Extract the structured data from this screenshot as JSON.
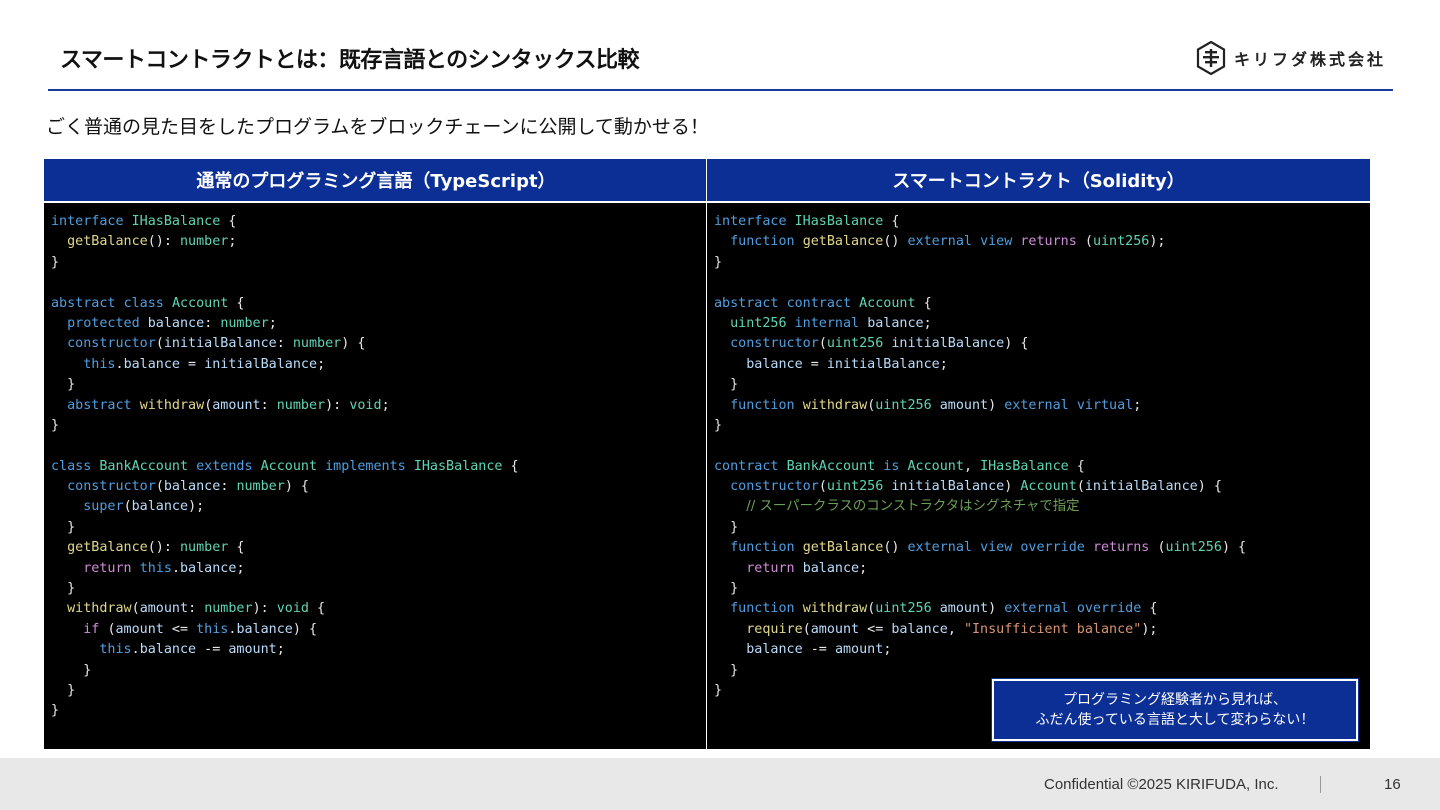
{
  "header": {
    "title": "スマートコントラクトとは：既存言語とのシンタックス比較",
    "logo_text": "キリフダ株式会社",
    "logo_icon": "kirifuda-logo-icon"
  },
  "subtitle": "ごく普通の見た目をしたプログラムをブロックチェーンに公開して動かせる！",
  "panels": {
    "left_title": "通常のプログラミング言語（TypeScript）",
    "right_title": "スマートコントラクト（Solidity）"
  },
  "code_colors": {
    "keyword": "#4f9ee0",
    "type": "#5fd4b4",
    "function": "#e2d88a",
    "variable": "#b9dcfa",
    "control": "#d08ad8",
    "string": "#d89470",
    "comment": "#6aa055"
  },
  "typescript_code": [
    [
      [
        "kw",
        "interface "
      ],
      [
        "ty",
        "IHasBalance"
      ],
      [
        "op",
        " {"
      ]
    ],
    [
      [
        "op",
        "  "
      ],
      [
        "fn",
        "getBalance"
      ],
      [
        "op",
        "(): "
      ],
      [
        "ty",
        "number"
      ],
      [
        "op",
        ";"
      ]
    ],
    [
      [
        "op",
        "}"
      ]
    ],
    [],
    [
      [
        "kw",
        "abstract "
      ],
      [
        "kw",
        "class "
      ],
      [
        "ty",
        "Account"
      ],
      [
        "op",
        " {"
      ]
    ],
    [
      [
        "op",
        "  "
      ],
      [
        "kw",
        "protected "
      ],
      [
        "va",
        "balance"
      ],
      [
        "op",
        ": "
      ],
      [
        "ty",
        "number"
      ],
      [
        "op",
        ";"
      ]
    ],
    [
      [
        "op",
        "  "
      ],
      [
        "kw",
        "constructor"
      ],
      [
        "op",
        "("
      ],
      [
        "va",
        "initialBalance"
      ],
      [
        "op",
        ": "
      ],
      [
        "ty",
        "number"
      ],
      [
        "op",
        ") {"
      ]
    ],
    [
      [
        "op",
        "    "
      ],
      [
        "kw",
        "this"
      ],
      [
        "op",
        "."
      ],
      [
        "va",
        "balance"
      ],
      [
        "op",
        " = "
      ],
      [
        "va",
        "initialBalance"
      ],
      [
        "op",
        ";"
      ]
    ],
    [
      [
        "op",
        "  }"
      ]
    ],
    [
      [
        "op",
        "  "
      ],
      [
        "kw",
        "abstract "
      ],
      [
        "fn",
        "withdraw"
      ],
      [
        "op",
        "("
      ],
      [
        "va",
        "amount"
      ],
      [
        "op",
        ": "
      ],
      [
        "ty",
        "number"
      ],
      [
        "op",
        "): "
      ],
      [
        "ty",
        "void"
      ],
      [
        "op",
        ";"
      ]
    ],
    [
      [
        "op",
        "}"
      ]
    ],
    [],
    [
      [
        "kw",
        "class "
      ],
      [
        "ty",
        "BankAccount"
      ],
      [
        "kw",
        " extends "
      ],
      [
        "ty",
        "Account"
      ],
      [
        "kw",
        " implements "
      ],
      [
        "ty",
        "IHasBalance"
      ],
      [
        "op",
        " {"
      ]
    ],
    [
      [
        "op",
        "  "
      ],
      [
        "kw",
        "constructor"
      ],
      [
        "op",
        "("
      ],
      [
        "va",
        "balance"
      ],
      [
        "op",
        ": "
      ],
      [
        "ty",
        "number"
      ],
      [
        "op",
        ") {"
      ]
    ],
    [
      [
        "op",
        "    "
      ],
      [
        "kw",
        "super"
      ],
      [
        "op",
        "("
      ],
      [
        "va",
        "balance"
      ],
      [
        "op",
        ");"
      ]
    ],
    [
      [
        "op",
        "  }"
      ]
    ],
    [
      [
        "op",
        "  "
      ],
      [
        "fn",
        "getBalance"
      ],
      [
        "op",
        "(): "
      ],
      [
        "ty",
        "number"
      ],
      [
        "op",
        " {"
      ]
    ],
    [
      [
        "op",
        "    "
      ],
      [
        "ct",
        "return "
      ],
      [
        "kw",
        "this"
      ],
      [
        "op",
        "."
      ],
      [
        "va",
        "balance"
      ],
      [
        "op",
        ";"
      ]
    ],
    [
      [
        "op",
        "  }"
      ]
    ],
    [
      [
        "op",
        "  "
      ],
      [
        "fn",
        "withdraw"
      ],
      [
        "op",
        "("
      ],
      [
        "va",
        "amount"
      ],
      [
        "op",
        ": "
      ],
      [
        "ty",
        "number"
      ],
      [
        "op",
        "): "
      ],
      [
        "ty",
        "void"
      ],
      [
        "op",
        " {"
      ]
    ],
    [
      [
        "op",
        "    "
      ],
      [
        "ct",
        "if "
      ],
      [
        "op",
        "("
      ],
      [
        "va",
        "amount"
      ],
      [
        "op",
        " <= "
      ],
      [
        "kw",
        "this"
      ],
      [
        "op",
        "."
      ],
      [
        "va",
        "balance"
      ],
      [
        "op",
        ") {"
      ]
    ],
    [
      [
        "op",
        "      "
      ],
      [
        "kw",
        "this"
      ],
      [
        "op",
        "."
      ],
      [
        "va",
        "balance"
      ],
      [
        "op",
        " -= "
      ],
      [
        "va",
        "amount"
      ],
      [
        "op",
        ";"
      ]
    ],
    [
      [
        "op",
        "    }"
      ]
    ],
    [
      [
        "op",
        "  }"
      ]
    ],
    [
      [
        "op",
        "}"
      ]
    ]
  ],
  "solidity_code": [
    [
      [
        "kw",
        "interface "
      ],
      [
        "ty",
        "IHasBalance"
      ],
      [
        "op",
        " {"
      ]
    ],
    [
      [
        "op",
        "  "
      ],
      [
        "kw",
        "function "
      ],
      [
        "fn",
        "getBalance"
      ],
      [
        "op",
        "() "
      ],
      [
        "kw",
        "external "
      ],
      [
        "kw",
        "view "
      ],
      [
        "ct",
        "returns "
      ],
      [
        "op",
        "("
      ],
      [
        "ty",
        "uint256"
      ],
      [
        "op",
        ");"
      ]
    ],
    [
      [
        "op",
        "}"
      ]
    ],
    [],
    [
      [
        "kw",
        "abstract "
      ],
      [
        "kw",
        "contract "
      ],
      [
        "ty",
        "Account"
      ],
      [
        "op",
        " {"
      ]
    ],
    [
      [
        "op",
        "  "
      ],
      [
        "ty",
        "uint256 "
      ],
      [
        "kw",
        "internal "
      ],
      [
        "va",
        "balance"
      ],
      [
        "op",
        ";"
      ]
    ],
    [
      [
        "op",
        "  "
      ],
      [
        "kw",
        "constructor"
      ],
      [
        "op",
        "("
      ],
      [
        "ty",
        "uint256 "
      ],
      [
        "va",
        "initialBalance"
      ],
      [
        "op",
        ") {"
      ]
    ],
    [
      [
        "op",
        "    "
      ],
      [
        "va",
        "balance"
      ],
      [
        "op",
        " = "
      ],
      [
        "va",
        "initialBalance"
      ],
      [
        "op",
        ";"
      ]
    ],
    [
      [
        "op",
        "  }"
      ]
    ],
    [
      [
        "op",
        "  "
      ],
      [
        "kw",
        "function "
      ],
      [
        "fn",
        "withdraw"
      ],
      [
        "op",
        "("
      ],
      [
        "ty",
        "uint256 "
      ],
      [
        "va",
        "amount"
      ],
      [
        "op",
        ") "
      ],
      [
        "kw",
        "external "
      ],
      [
        "kw",
        "virtual"
      ],
      [
        "op",
        ";"
      ]
    ],
    [
      [
        "op",
        "}"
      ]
    ],
    [],
    [
      [
        "kw",
        "contract "
      ],
      [
        "ty",
        "BankAccount"
      ],
      [
        "kw",
        " is "
      ],
      [
        "ty",
        "Account"
      ],
      [
        "op",
        ", "
      ],
      [
        "ty",
        "IHasBalance"
      ],
      [
        "op",
        " {"
      ]
    ],
    [
      [
        "op",
        "  "
      ],
      [
        "kw",
        "constructor"
      ],
      [
        "op",
        "("
      ],
      [
        "ty",
        "uint256 "
      ],
      [
        "va",
        "initialBalance"
      ],
      [
        "op",
        ") "
      ],
      [
        "ty",
        "Account"
      ],
      [
        "op",
        "("
      ],
      [
        "va",
        "initialBalance"
      ],
      [
        "op",
        ") {"
      ]
    ],
    [
      [
        "op",
        "    "
      ],
      [
        "cm",
        "// スーパークラスのコンストラクタはシグネチャで指定"
      ]
    ],
    [
      [
        "op",
        "  }"
      ]
    ],
    [
      [
        "op",
        "  "
      ],
      [
        "kw",
        "function "
      ],
      [
        "fn",
        "getBalance"
      ],
      [
        "op",
        "() "
      ],
      [
        "kw",
        "external "
      ],
      [
        "kw",
        "view "
      ],
      [
        "kw",
        "override "
      ],
      [
        "ct",
        "returns "
      ],
      [
        "op",
        "("
      ],
      [
        "ty",
        "uint256"
      ],
      [
        "op",
        ") {"
      ]
    ],
    [
      [
        "op",
        "    "
      ],
      [
        "ct",
        "return "
      ],
      [
        "va",
        "balance"
      ],
      [
        "op",
        ";"
      ]
    ],
    [
      [
        "op",
        "  }"
      ]
    ],
    [
      [
        "op",
        "  "
      ],
      [
        "kw",
        "function "
      ],
      [
        "fn",
        "withdraw"
      ],
      [
        "op",
        "("
      ],
      [
        "ty",
        "uint256 "
      ],
      [
        "va",
        "amount"
      ],
      [
        "op",
        ") "
      ],
      [
        "kw",
        "external "
      ],
      [
        "kw",
        "override"
      ],
      [
        "op",
        " {"
      ]
    ],
    [
      [
        "op",
        "    "
      ],
      [
        "fn",
        "require"
      ],
      [
        "op",
        "("
      ],
      [
        "va",
        "amount"
      ],
      [
        "op",
        " <= "
      ],
      [
        "va",
        "balance"
      ],
      [
        "op",
        ", "
      ],
      [
        "st",
        "\"Insufficient balance\""
      ],
      [
        "op",
        ");"
      ]
    ],
    [
      [
        "op",
        "    "
      ],
      [
        "va",
        "balance"
      ],
      [
        "op",
        " -= "
      ],
      [
        "va",
        "amount"
      ],
      [
        "op",
        ";"
      ]
    ],
    [
      [
        "op",
        "  }"
      ]
    ],
    [
      [
        "op",
        "}"
      ]
    ]
  ],
  "note": {
    "line1": "プログラミング経験者から見れば、",
    "line2": "ふだん使っている言語と大して変わらない！"
  },
  "footer": {
    "confidential": "Confidential ©2025 KIRIFUDA, Inc.",
    "page_number": "16"
  }
}
